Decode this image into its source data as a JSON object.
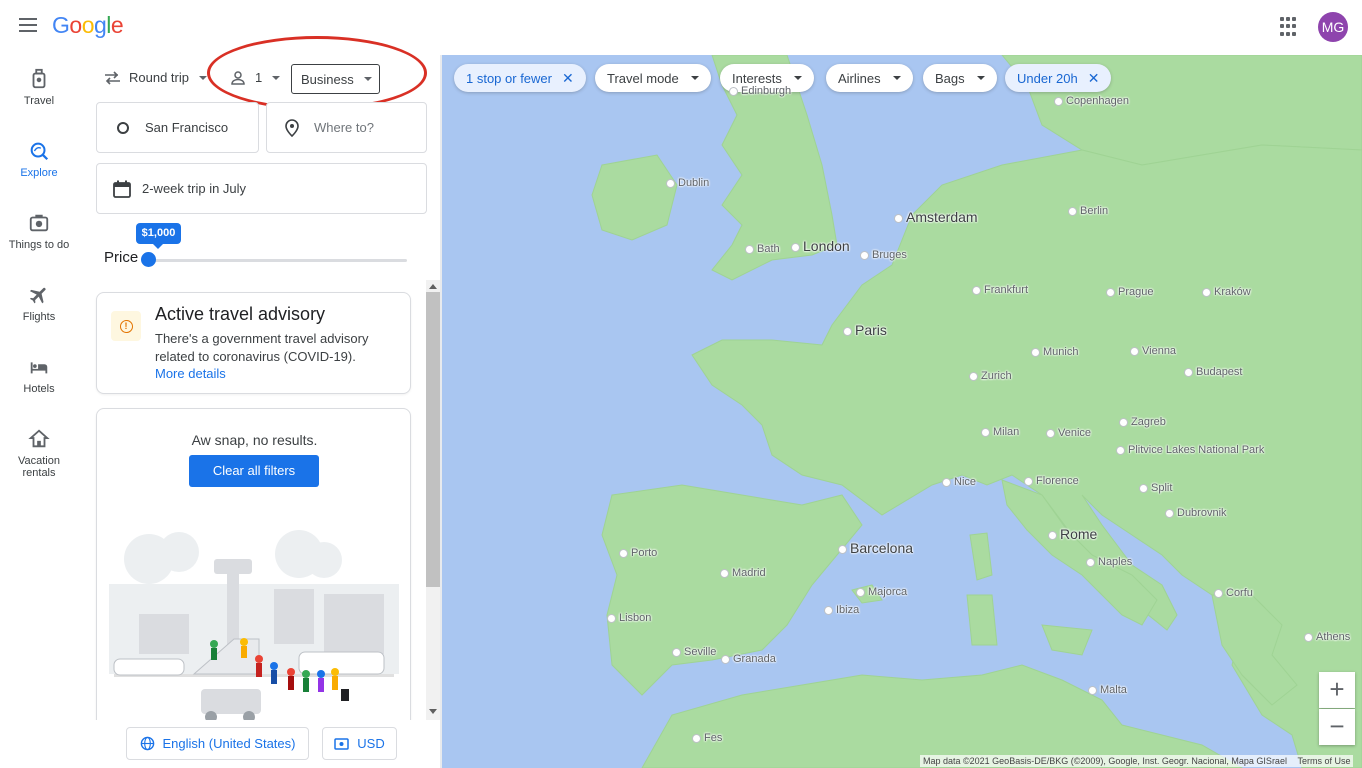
{
  "header": {
    "logo": "Google",
    "avatar_initials": "MG",
    "avatar_color": "#8e44ad"
  },
  "nav": [
    {
      "label": "Travel",
      "icon": "luggage-icon"
    },
    {
      "label": "Explore",
      "icon": "explore-icon",
      "active": true
    },
    {
      "label": "Things to do",
      "icon": "camera-icon"
    },
    {
      "label": "Flights",
      "icon": "airplane-icon"
    },
    {
      "label": "Hotels",
      "icon": "bed-icon"
    },
    {
      "label": "Vacation rentals",
      "icon": "house-icon"
    }
  ],
  "search": {
    "trip_type": "Round trip",
    "passengers": "1",
    "cabin_class": "Business",
    "origin": "San Francisco",
    "destination_placeholder": "Where to?",
    "dates": "2-week trip in July"
  },
  "price": {
    "label": "Price",
    "max_value": "$1,000",
    "slider_fraction": 0.0
  },
  "advisory": {
    "title": "Active travel advisory",
    "body": "There's a government travel advisory related to coronavirus (COVID-19).",
    "link": "More details"
  },
  "results": {
    "empty_message": "Aw snap, no results.",
    "clear_button": "Clear all filters"
  },
  "footer": {
    "language": "English (United States)",
    "currency": "USD"
  },
  "filters": [
    {
      "label": "1 stop or fewer",
      "active": true
    },
    {
      "label": "Travel mode",
      "active": false
    },
    {
      "label": "Interests",
      "active": false
    },
    {
      "label": "Airlines",
      "active": false
    },
    {
      "label": "Bags",
      "active": false
    },
    {
      "label": "Under 20h",
      "active": true
    }
  ],
  "map": {
    "cities": [
      {
        "name": "Edinburgh",
        "size": "small"
      },
      {
        "name": "Copenhagen",
        "size": "small"
      },
      {
        "name": "Dublin",
        "size": "small"
      },
      {
        "name": "Amsterdam",
        "size": "big"
      },
      {
        "name": "Berlin",
        "size": "small"
      },
      {
        "name": "Bath",
        "size": "small"
      },
      {
        "name": "London",
        "size": "big"
      },
      {
        "name": "Bruges",
        "size": "small"
      },
      {
        "name": "Frankfurt",
        "size": "small"
      },
      {
        "name": "Prague",
        "size": "small"
      },
      {
        "name": "Kraków",
        "size": "small"
      },
      {
        "name": "Paris",
        "size": "big"
      },
      {
        "name": "Munich",
        "size": "small"
      },
      {
        "name": "Vienna",
        "size": "small"
      },
      {
        "name": "Budapest",
        "size": "small"
      },
      {
        "name": "Zurich",
        "size": "small"
      },
      {
        "name": "Zagreb",
        "size": "small"
      },
      {
        "name": "Milan",
        "size": "small"
      },
      {
        "name": "Venice",
        "size": "small"
      },
      {
        "name": "Plitvice Lakes National Park",
        "size": "small"
      },
      {
        "name": "Nice",
        "size": "small"
      },
      {
        "name": "Florence",
        "size": "small"
      },
      {
        "name": "Split",
        "size": "small"
      },
      {
        "name": "Dubrovnik",
        "size": "small"
      },
      {
        "name": "Rome",
        "size": "big"
      },
      {
        "name": "Barcelona",
        "size": "big"
      },
      {
        "name": "Porto",
        "size": "small"
      },
      {
        "name": "Madrid",
        "size": "small"
      },
      {
        "name": "Naples",
        "size": "small"
      },
      {
        "name": "Majorca",
        "size": "small"
      },
      {
        "name": "Ibiza",
        "size": "small"
      },
      {
        "name": "Corfu",
        "size": "small"
      },
      {
        "name": "Lisbon",
        "size": "small"
      },
      {
        "name": "Athens",
        "size": "small"
      },
      {
        "name": "Seville",
        "size": "small"
      },
      {
        "name": "Granada",
        "size": "small"
      },
      {
        "name": "Malta",
        "size": "small"
      },
      {
        "name": "Fes",
        "size": "small"
      }
    ],
    "attribution": "Map data ©2021 GeoBasis-DE/BKG (©2009), Google, Inst. Geogr. Nacional, Mapa GISrael",
    "terms": "Terms of Use",
    "land_color": "#aadba0",
    "water_color": "#a9c6f1"
  }
}
